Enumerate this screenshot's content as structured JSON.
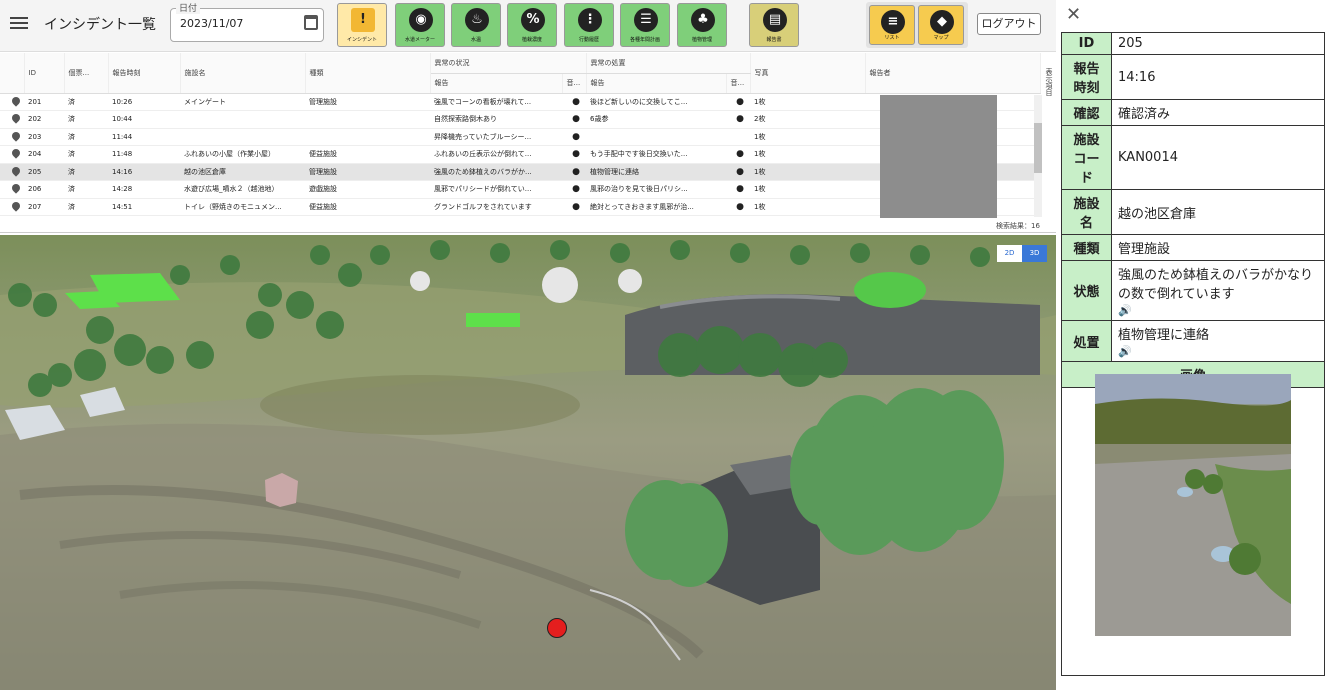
{
  "header": {
    "title": "インシデント一覧",
    "date_label": "日付",
    "date_value": "2023/11/07",
    "logout": "ログアウト"
  },
  "toolbar": [
    {
      "label": "インシデント",
      "glyph": "!"
    },
    {
      "label": "水道メーター",
      "glyph": "◉"
    },
    {
      "label": "水温",
      "glyph": "♨"
    },
    {
      "label": "植栽濃度",
      "glyph": "%"
    },
    {
      "label": "行動履歴",
      "glyph": "⋮"
    },
    {
      "label": "各種年間計画",
      "glyph": "☰"
    },
    {
      "label": "植物管理",
      "glyph": "♣"
    },
    {
      "label": "報告書",
      "glyph": "▤"
    },
    {
      "label": "リスト",
      "glyph": "≡"
    },
    {
      "label": "マップ",
      "glyph": "◆"
    }
  ],
  "table": {
    "group_status": "異常の状況",
    "group_action": "異常の処置",
    "headers": [
      "ID",
      "個票...",
      "報告時刻",
      "施設名",
      "種類",
      "報告",
      "音...",
      "報告",
      "音...",
      "写真",
      "報告者"
    ],
    "rows": [
      {
        "id": "201",
        "check": "済",
        "time": "10:26",
        "facility": "メインゲート",
        "type": "管理施設",
        "status": "強風でコーンの看板が壊れて...",
        "s_voice": "●",
        "action": "後ほど新しいのに交換してこ...",
        "a_voice": "●",
        "photo": "1枚"
      },
      {
        "id": "202",
        "check": "済",
        "time": "10:44",
        "facility": "",
        "type": "",
        "status": "自然探索路倒木あり",
        "s_voice": "●",
        "action": "6歳参",
        "a_voice": "●",
        "photo": "2枚"
      },
      {
        "id": "203",
        "check": "済",
        "time": "11:44",
        "facility": "",
        "type": "",
        "status": "昇降機売っていたブルーシー...",
        "s_voice": "●",
        "action": "",
        "a_voice": "",
        "photo": "1枚"
      },
      {
        "id": "204",
        "check": "済",
        "time": "11:48",
        "facility": "ふれあいの小屋（作業小屋）",
        "type": "便益施設",
        "status": "ふれあいの丘表示公が倒れて...",
        "s_voice": "●",
        "action": "もう手配中です後日交換いた...",
        "a_voice": "●",
        "photo": "1枚"
      },
      {
        "id": "205",
        "check": "済",
        "time": "14:16",
        "facility": "越の池区倉庫",
        "type": "管理施設",
        "status": "強風のため鉢植えのバラがか...",
        "s_voice": "●",
        "action": "植物管理に連絡",
        "a_voice": "●",
        "photo": "1枚"
      },
      {
        "id": "206",
        "check": "済",
        "time": "14:28",
        "facility": "水遊び広場_噴水２（越池地）",
        "type": "遊戯施設",
        "status": "風邪でパリシードが倒れてい...",
        "s_voice": "●",
        "action": "風邪の治りを見て後日パリシ...",
        "a_voice": "●",
        "photo": "1枚"
      },
      {
        "id": "207",
        "check": "済",
        "time": "14:51",
        "facility": "トイレ（野焼きのモニュメン...",
        "type": "便益施設",
        "status": "グランドゴルフをされています",
        "s_voice": "●",
        "action": "絶対とってきおきます風邪が治...",
        "a_voice": "●",
        "photo": "1枚"
      }
    ],
    "column_toggle": "表示項目",
    "result_count": "検索結果：16"
  },
  "map": {
    "btn_2d": "2D",
    "btn_3d": "3D",
    "marker_color": "#e41e1e"
  },
  "detail": {
    "close": "✕",
    "rows": [
      {
        "key": "ID",
        "value": "205"
      },
      {
        "key": "報告時刻",
        "value": "14:16"
      },
      {
        "key": "確認",
        "value": "確認済み"
      },
      {
        "key": "施設コード",
        "value": "KAN0014"
      },
      {
        "key": "施設名",
        "value": "越の池区倉庫"
      },
      {
        "key": "種類",
        "value": "管理施設"
      },
      {
        "key": "状態",
        "value": "強風のため鉢植えのバラがかなりの数で倒れています"
      },
      {
        "key": "処置",
        "value": "植物管理に連絡"
      }
    ],
    "image_header": "画像",
    "voice_icon": "🔊"
  },
  "colors": {
    "accent_green": "#7fcf7a",
    "header_green": "#c8efc8",
    "selected_row": "#e4e4e4"
  }
}
